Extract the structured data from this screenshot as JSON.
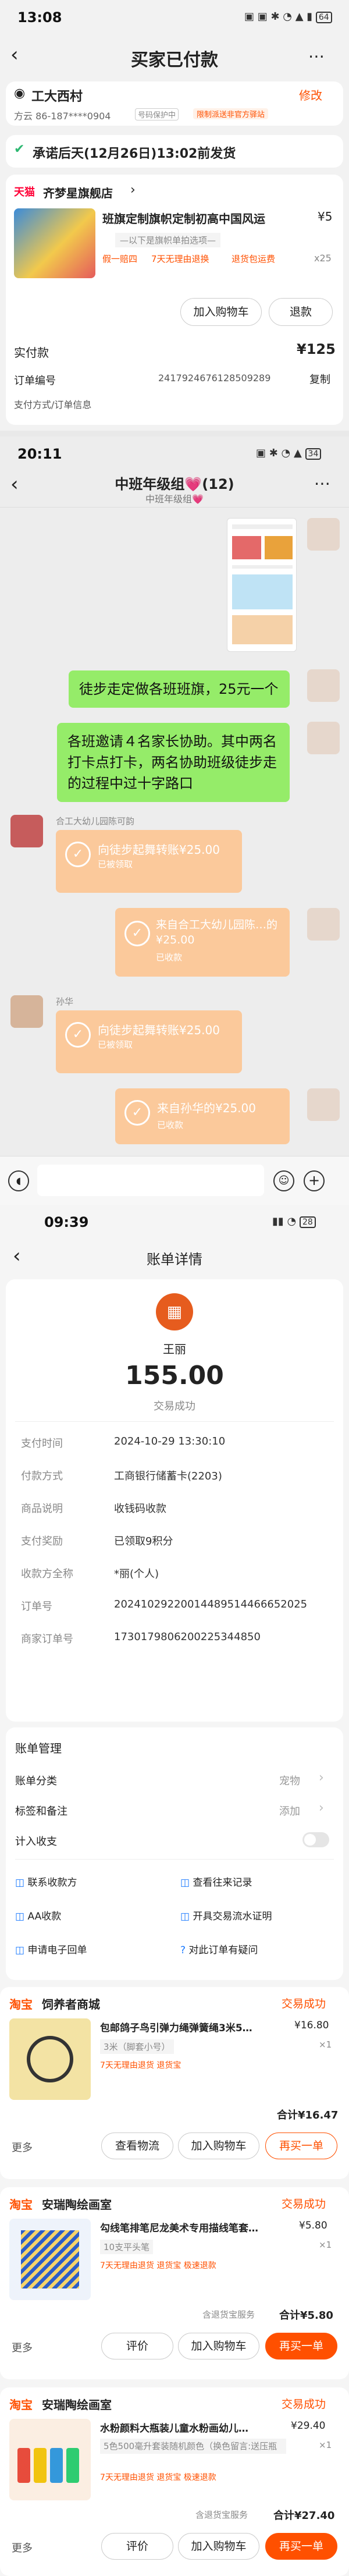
{
  "s1": {
    "time": "13:08",
    "battery": "64",
    "title": "买家已付款",
    "addr_name": "工大西村",
    "addr_edit": "修改",
    "addr_phone": "方云 86-187****0904",
    "addr_protect": "号码保护中",
    "addr_tag": "限制派送非官方驿站",
    "promise": "承诺后天(12月26日)13:02前发货",
    "store": "齐梦星旗舰店",
    "store_badge": "天猫",
    "product": "班旗定制旗帜定制初高中国风运",
    "price": "¥5",
    "qty": "x25",
    "note": "—以下是旗帜单拍选项—",
    "tag1": "假一赔四",
    "tag2": "7天无理由退换",
    "tag3": "退货包运费",
    "btn_cart": "加入购物车",
    "btn_refund": "退款",
    "paid_label": "实付款",
    "paid_value": "¥125",
    "order_label": "订单编号",
    "order_no": "2417924676128509289",
    "copy": "复制",
    "info_more": "支付方式/订单信息"
  },
  "s2": {
    "time": "20:11",
    "battery": "34",
    "title": "中班年级组💗(12)",
    "subtitle": "中班年级组💗",
    "msg1": "徒步走定做各班班旗，25元一个",
    "msg2": "各班邀请４名家长协助。其中两名打卡点打卡，两名协助班级徒步走的过程中过十字路口",
    "sender1": "合工大幼儿园陈可韵",
    "tf1_title": "向徒步起舞转账¥25.00",
    "tf1_sub": "已被领取",
    "tf2_title": "来自合工大幼儿园陈…的¥25.00",
    "tf2_sub": "已收款",
    "sender2": "孙华",
    "tf3_title": "向徒步起舞转账¥25.00",
    "tf3_sub": "已被领取",
    "tf4_title": "来自孙华的¥25.00",
    "tf4_sub": "已收款"
  },
  "s3": {
    "time": "09:39",
    "battery": "28",
    "title": "账单详情",
    "payee": "王丽",
    "amount": "155.00",
    "status": "交易成功",
    "rows": [
      {
        "k": "支付时间",
        "v": "2024-10-29 13:30:10"
      },
      {
        "k": "付款方式",
        "v": "工商银行储蓄卡(2203)"
      },
      {
        "k": "商品说明",
        "v": "收钱码收款"
      },
      {
        "k": "支付奖励",
        "v": "已领取9积分"
      },
      {
        "k": "收款方全称",
        "v": "*丽(个人)"
      },
      {
        "k": "订单号",
        "v": "20241029220014489514466652025"
      },
      {
        "k": "商家订单号",
        "v": "1730179806200225344850"
      }
    ],
    "mgmt_title": "账单管理",
    "m1_k": "账单分类",
    "m1_v": "宠物",
    "m2_k": "标签和备注",
    "m2_v": "添加",
    "m3_k": "计入收支",
    "act1": "联系收款方",
    "act2": "查看往来记录",
    "act3": "AA收款",
    "act4": "开具交易流水证明",
    "act5": "申请电子回单",
    "act6": "对此订单有疑问",
    "o1": {
      "logo": "淘宝",
      "store": "饲养者商城",
      "status": "交易成功",
      "title": "包邮鸽子鸟引弹力绳弹簧绳3米5…",
      "spec": "3米（脚套小号）",
      "price": "¥16.80",
      "qty": "×1",
      "tags": "7天无理由退货  退货宝",
      "total": "合计¥16.47",
      "more": "更多",
      "b1": "查看物流",
      "b2": "加入购物车",
      "b3": "再买一单"
    },
    "o2": {
      "logo": "淘宝",
      "store": "安瑞陶绘画室",
      "status": "交易成功",
      "title": "勾线笔排笔尼龙美术专用描线笔套…",
      "spec": "10支平头笔",
      "price": "¥5.80",
      "qty": "×1",
      "tags": "7天无理由退货  退货宝  极速退款",
      "total": "合计¥5.80",
      "svc": "含退货宝服务",
      "more": "更多",
      "b1": "评价",
      "b2": "加入购物车",
      "b3": "再买一单"
    },
    "o3": {
      "logo": "淘宝",
      "store": "安瑞陶绘画室",
      "status": "交易成功",
      "title": "水粉颜料大瓶装儿童水粉画幼儿…",
      "spec": "5色500毫升套装随机颜色（换色留言:送压瓶",
      "price": "¥29.40",
      "qty": "×1",
      "tags": "7天无理由退货  退货宝  极速退款",
      "total": "合计¥27.40",
      "svc": "含退货宝服务",
      "more": "更多",
      "b1": "评价",
      "b2": "加入购物车",
      "b3": "再买一单"
    }
  }
}
